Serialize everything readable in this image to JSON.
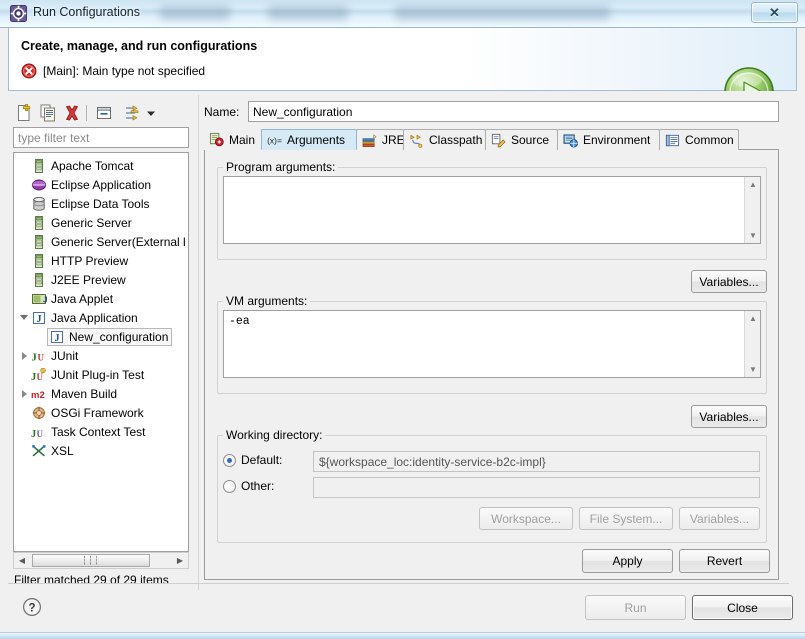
{
  "window": {
    "title": "Run Configurations",
    "icon": "eclipse-gear-icon",
    "close_label": "✕"
  },
  "banner": {
    "title": "Create, manage, and run configurations",
    "error_icon": "error-icon",
    "error_text": "[Main]: Main type not specified",
    "run_icon": "run-play-icon"
  },
  "tree_toolbar": {
    "buttons": [
      {
        "name": "new-launch-configuration",
        "icon": "new-document-icon"
      },
      {
        "name": "duplicate-launch-configuration",
        "icon": "duplicate-icon"
      },
      {
        "name": "delete-launch-configuration",
        "icon": "delete-x-icon"
      },
      {
        "name": "collapse-all",
        "icon": "collapse-all-icon"
      },
      {
        "name": "filter-menu",
        "icon": "filter-arrows-icon"
      },
      {
        "name": "view-menu",
        "icon": "chevron-down-icon"
      }
    ]
  },
  "filter": {
    "placeholder": "type filter text",
    "value": "",
    "status": "Filter matched 29 of 29 items"
  },
  "tree": {
    "items": [
      {
        "label": "Apache Tomcat",
        "icon": "server-icon",
        "indent": 0,
        "arrow": "none",
        "selected": false
      },
      {
        "label": "Eclipse Application",
        "icon": "eclipse-globe-icon",
        "indent": 0,
        "arrow": "none",
        "selected": false
      },
      {
        "label": "Eclipse Data Tools",
        "icon": "database-icon",
        "indent": 0,
        "arrow": "none",
        "selected": false
      },
      {
        "label": "Generic Server",
        "icon": "server-icon",
        "indent": 0,
        "arrow": "none",
        "selected": false
      },
      {
        "label": "Generic Server(External l",
        "icon": "server-icon",
        "indent": 0,
        "arrow": "none",
        "selected": false
      },
      {
        "label": "HTTP Preview",
        "icon": "server-icon",
        "indent": 0,
        "arrow": "none",
        "selected": false
      },
      {
        "label": "J2EE Preview",
        "icon": "server-icon",
        "indent": 0,
        "arrow": "none",
        "selected": false
      },
      {
        "label": "Java Applet",
        "icon": "java-applet-icon",
        "indent": 0,
        "arrow": "none",
        "selected": false
      },
      {
        "label": "Java Application",
        "icon": "java-app-icon",
        "indent": 0,
        "arrow": "expanded",
        "selected": false
      },
      {
        "label": "New_configuration",
        "icon": "java-app-icon",
        "indent": 1,
        "arrow": "none",
        "selected": true
      },
      {
        "label": "JUnit",
        "icon": "junit-icon",
        "indent": 0,
        "arrow": "collapsed",
        "selected": false
      },
      {
        "label": "JUnit Plug-in Test",
        "icon": "junit-plugin-icon",
        "indent": 0,
        "arrow": "none",
        "selected": false
      },
      {
        "label": "Maven Build",
        "icon": "maven-m2-icon",
        "indent": 0,
        "arrow": "collapsed",
        "selected": false
      },
      {
        "label": "OSGi Framework",
        "icon": "osgi-icon",
        "indent": 0,
        "arrow": "none",
        "selected": false
      },
      {
        "label": "Task Context Test",
        "icon": "junit-task-icon",
        "indent": 0,
        "arrow": "none",
        "selected": false
      },
      {
        "label": "XSL",
        "icon": "xsl-icon",
        "indent": 0,
        "arrow": "none",
        "selected": false
      }
    ]
  },
  "config": {
    "name_label": "Name:",
    "name_value": "New_configuration"
  },
  "tabs": [
    {
      "label": "Main",
      "icon": "main-tab-icon",
      "active": false
    },
    {
      "label": "Arguments",
      "icon": "arguments-tab-icon",
      "active": true
    },
    {
      "label": "JRE",
      "icon": "jre-tab-icon",
      "active": false
    },
    {
      "label": "Classpath",
      "icon": "classpath-tab-icon",
      "active": false
    },
    {
      "label": "Source",
      "icon": "source-tab-icon",
      "active": false
    },
    {
      "label": "Environment",
      "icon": "environment-tab-icon",
      "active": false
    },
    {
      "label": "Common",
      "icon": "common-tab-icon",
      "active": false
    }
  ],
  "arguments_tab": {
    "program_arguments": {
      "legend": "Program arguments:",
      "value": "",
      "variables_button": "Variables..."
    },
    "vm_arguments": {
      "legend": "VM arguments:",
      "value": "-ea",
      "variables_button": "Variables..."
    },
    "working_directory": {
      "legend": "Working directory:",
      "default_label": "Default:",
      "default_selected": true,
      "default_value": "${workspace_loc:identity-service-b2c-impl}",
      "other_label": "Other:",
      "other_selected": false,
      "other_value": "",
      "workspace_button": "Workspace...",
      "file_system_button": "File System...",
      "variables_button": "Variables..."
    }
  },
  "footer": {
    "apply_label": "Apply",
    "revert_label": "Revert",
    "run_label": "Run",
    "close_label": "Close",
    "run_enabled": false,
    "help_icon": "help-question-icon"
  },
  "colors": {
    "accent_tab": "#d6eaf6",
    "error_red": "#cc2222",
    "run_green": "#5aa832",
    "title_glass": "#cfe4f2"
  }
}
